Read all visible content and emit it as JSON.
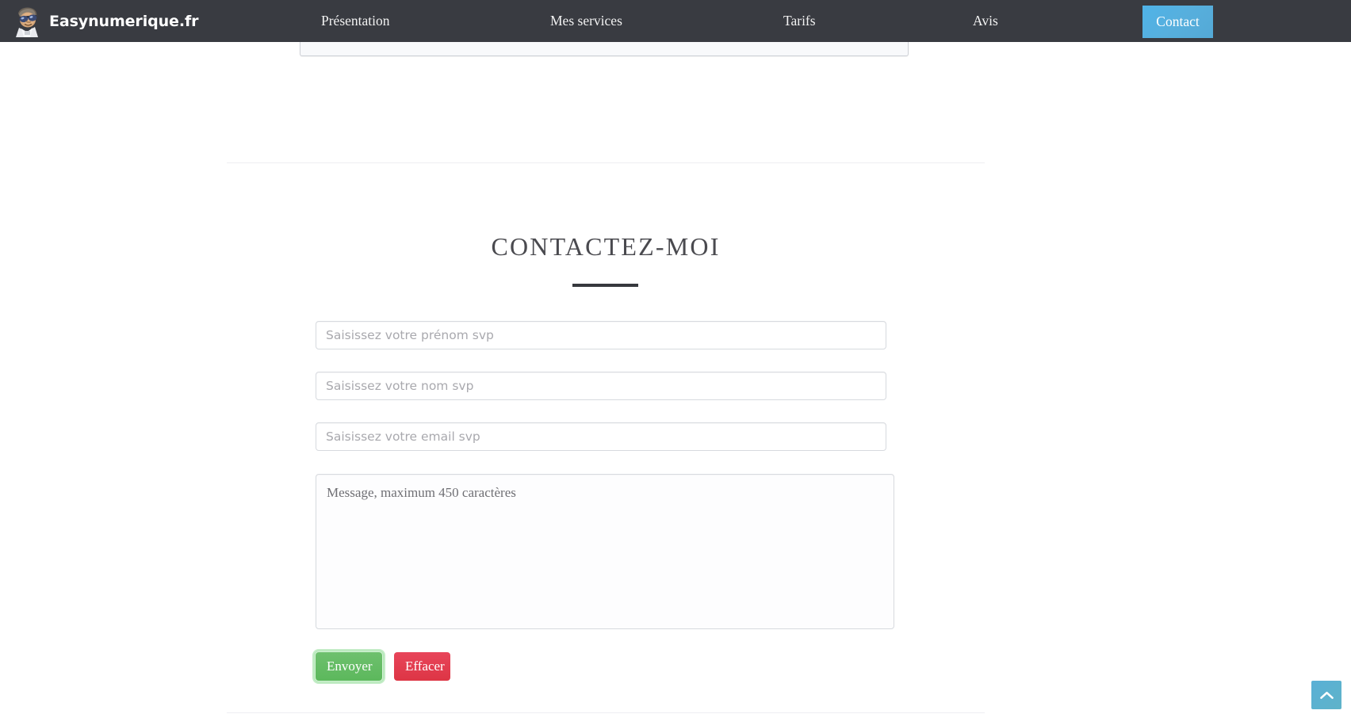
{
  "site": {
    "brand_name": "Easynumerique.fr",
    "logo_icon": "mascot-logo-icon",
    "navbar_color": "#393b41",
    "accent_color": "#54a9d6"
  },
  "nav": {
    "items": [
      {
        "label": "Présentation"
      },
      {
        "label": "Mes services"
      },
      {
        "label": "Tarifs"
      },
      {
        "label": "Avis"
      }
    ],
    "cta": {
      "label": "Contact"
    }
  },
  "contact_section": {
    "title": "CONTACTEZ-MOI",
    "form": {
      "first_name": {
        "placeholder": "Saisissez votre prénom svp",
        "value": ""
      },
      "last_name": {
        "placeholder": "Saisissez votre nom svp",
        "value": ""
      },
      "email": {
        "placeholder": "Saisissez votre email svp",
        "value": ""
      },
      "message": {
        "placeholder": "Message, maximum 450 caractères",
        "value": "",
        "max_characters": "450"
      },
      "submit_label": "Envoyer",
      "reset_label": "Effacer",
      "submit_color": "#5cb85c",
      "reset_color": "#dd3545"
    }
  },
  "scroll_top": {
    "icon": "chevron-up-icon",
    "color": "#59b0d6"
  }
}
